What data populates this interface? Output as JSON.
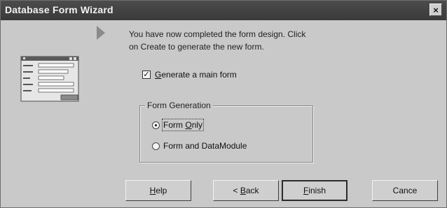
{
  "window": {
    "title": "Database Form Wizard",
    "close_glyph": "×"
  },
  "message": {
    "line1": "You have now completed the form design. Click",
    "line2": "on Create to generate the new form."
  },
  "options": {
    "generate_main_form": {
      "label_accel": "G",
      "label_rest": "enerate a main form",
      "checked": true,
      "check_glyph": "✓"
    }
  },
  "form_generation": {
    "legend": "Form Generation",
    "form_only": {
      "label_pre": "Form ",
      "label_accel": "O",
      "label_rest": "nly",
      "selected": true
    },
    "form_and_datamodule": {
      "label": "Form and DataModule",
      "selected": false
    }
  },
  "buttons": {
    "help_accel": "H",
    "help_rest": "elp",
    "back_pre": "< ",
    "back_accel": "B",
    "back_rest": "ack",
    "finish_accel": "F",
    "finish_rest": "inish",
    "cancel": "Cance"
  },
  "icons": {
    "close": "close-icon",
    "pointer": "wizard-pointer-icon",
    "illustration": "form-illustration-icon"
  },
  "colors": {
    "titlebar": "#3f3f3f",
    "dialog_bg": "#c9c9c9",
    "button_face": "#cfcfcf"
  }
}
